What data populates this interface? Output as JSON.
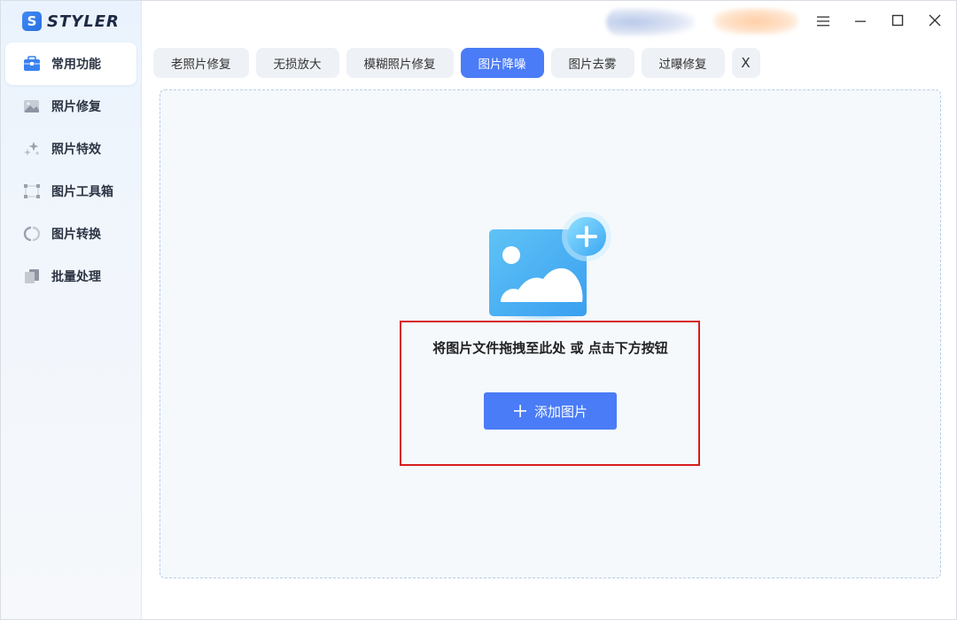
{
  "app": {
    "logo_letter": "S",
    "name": "STYLER"
  },
  "sidebar": {
    "items": [
      {
        "label": "常用功能",
        "icon": "briefcase-icon",
        "active": true
      },
      {
        "label": "照片修复",
        "icon": "photo-icon",
        "active": false
      },
      {
        "label": "照片特效",
        "icon": "sparkle-icon",
        "active": false
      },
      {
        "label": "图片工具箱",
        "icon": "crop-frame-icon",
        "active": false
      },
      {
        "label": "图片转换",
        "icon": "convert-icon",
        "active": false
      },
      {
        "label": "批量处理",
        "icon": "stack-icon",
        "active": false
      }
    ]
  },
  "window": {
    "menu_icon": "menu-icon",
    "minimize_icon": "minimize-icon",
    "maximize_icon": "maximize-icon",
    "close_icon": "close-icon"
  },
  "tabs": {
    "items": [
      {
        "label": "老照片修复",
        "active": false
      },
      {
        "label": "无损放大",
        "active": false
      },
      {
        "label": "模糊照片修复",
        "active": false
      },
      {
        "label": "图片降噪",
        "active": true
      },
      {
        "label": "图片去雾",
        "active": false
      },
      {
        "label": "过曝修复",
        "active": false
      }
    ],
    "close_label": "X"
  },
  "dropzone": {
    "hint": "将图片文件拖拽至此处 或 点击下方按钮",
    "add_button_label": "添加图片",
    "icon": "add-image-icon"
  },
  "colors": {
    "accent": "#4a7cf7",
    "highlight": "#d71d1d",
    "sidebar_bg": "#eaf3fd",
    "dropzone_bg": "#f5f9fc"
  }
}
